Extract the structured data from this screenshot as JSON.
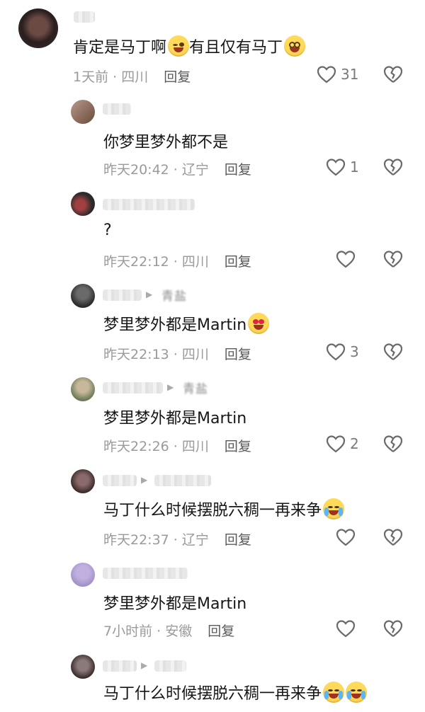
{
  "comments": [
    {
      "kind": "main",
      "text": "肯定是马丁啊",
      "emoji1": "face-with-tongue",
      "text2": "有且仅有马丁",
      "emoji2": "dizzy-face",
      "time": "1天前 · 四川",
      "reply": "回复",
      "likes": "31",
      "avatar_color": "#3a2a2a"
    },
    {
      "kind": "reply",
      "text": "你梦里梦外都不是",
      "time": "昨天20:42 · 辽宁",
      "reply": "回复",
      "likes": "1",
      "avatar_color": "#8a6a5a"
    },
    {
      "kind": "reply",
      "text": "?",
      "time": "昨天22:12 · 四川",
      "reply": "回复",
      "likes": "",
      "avatar_color": "#4a3a3a"
    },
    {
      "kind": "reply",
      "text": "梦里梦外都是Martin",
      "emoji": "heart-eyes",
      "time": "昨天22:13 · 四川",
      "reply": "回复",
      "likes": "3",
      "avatar_color": "#3a3a3a",
      "reply_to": "青盐"
    },
    {
      "kind": "reply",
      "text": "梦里梦外都是Martin",
      "time": "昨天22:26 · 四川",
      "reply": "回复",
      "likes": "2",
      "avatar_color": "#7a8a6a",
      "reply_to": "青盐"
    },
    {
      "kind": "reply",
      "text": "马丁什么时候摆脱六稠一再来争",
      "emoji": "crying-laughing",
      "time": "昨天22:37 · 辽宁",
      "reply": "回复",
      "likes": "",
      "avatar_color": "#5a4a4a"
    },
    {
      "kind": "reply",
      "text": "梦里梦外都是Martin",
      "time": "7小时前 · 安徽",
      "reply": "回复",
      "likes": "",
      "avatar_color": "#a89ac8"
    },
    {
      "kind": "reply",
      "text": "马丁什么时候摆脱六稠一再来争",
      "emoji": "crying-laughing",
      "emoji_count": 2,
      "avatar_color": "#6a5a5a"
    }
  ]
}
